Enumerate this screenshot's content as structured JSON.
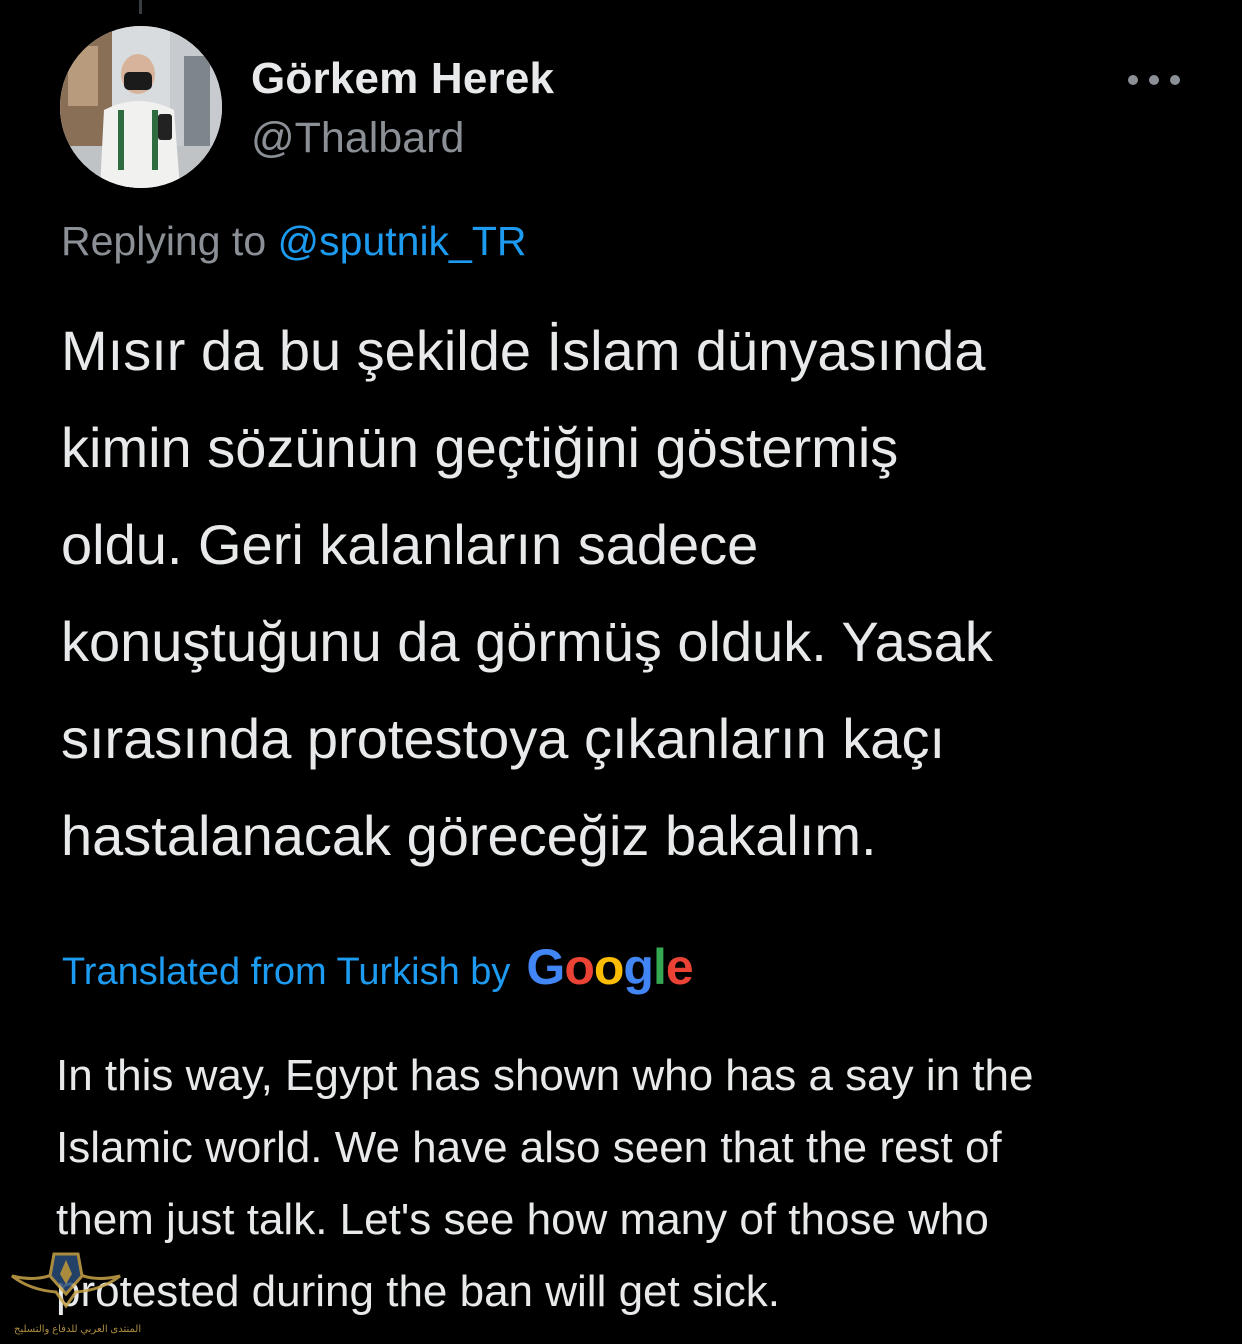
{
  "tweet": {
    "author": {
      "display_name": "Görkem Herek",
      "handle": "@Thalbard"
    },
    "more_icon": "more-horizontal-icon",
    "replying_prefix": "Replying to",
    "replying_to": "@sputnik_TR",
    "text_lines": [
      "Mısır da bu şekilde İslam dünyasında",
      "kimin sözünün geçtiğini göstermiş",
      "oldu. Geri kalanların sadece",
      "konuştuğunu da görmüş olduk. Yasak",
      "sırasında protestoya çıkanların kaçı",
      "hastalanacak göreceğiz bakalım."
    ],
    "translation": {
      "label": "Translated from Turkish by",
      "provider_letters": [
        "G",
        "o",
        "o",
        "g",
        "l",
        "e"
      ],
      "lines": [
        "In this way, Egypt has shown who has a say in the",
        "Islamic world. We have also seen that the rest of",
        "them just talk. Let's see how many of those who",
        "protested during the ban will get sick."
      ]
    }
  },
  "watermark": {
    "text_ar": "المنتدى العربي للدفاع والتسليح"
  },
  "colors": {
    "background": "#000000",
    "text": "#e7e9ea",
    "secondary": "#8b9096",
    "link": "#1d9bf0",
    "google_blue": "#4285f4",
    "google_red": "#ea4335",
    "google_yellow": "#fbbc05",
    "google_green": "#34a853"
  }
}
